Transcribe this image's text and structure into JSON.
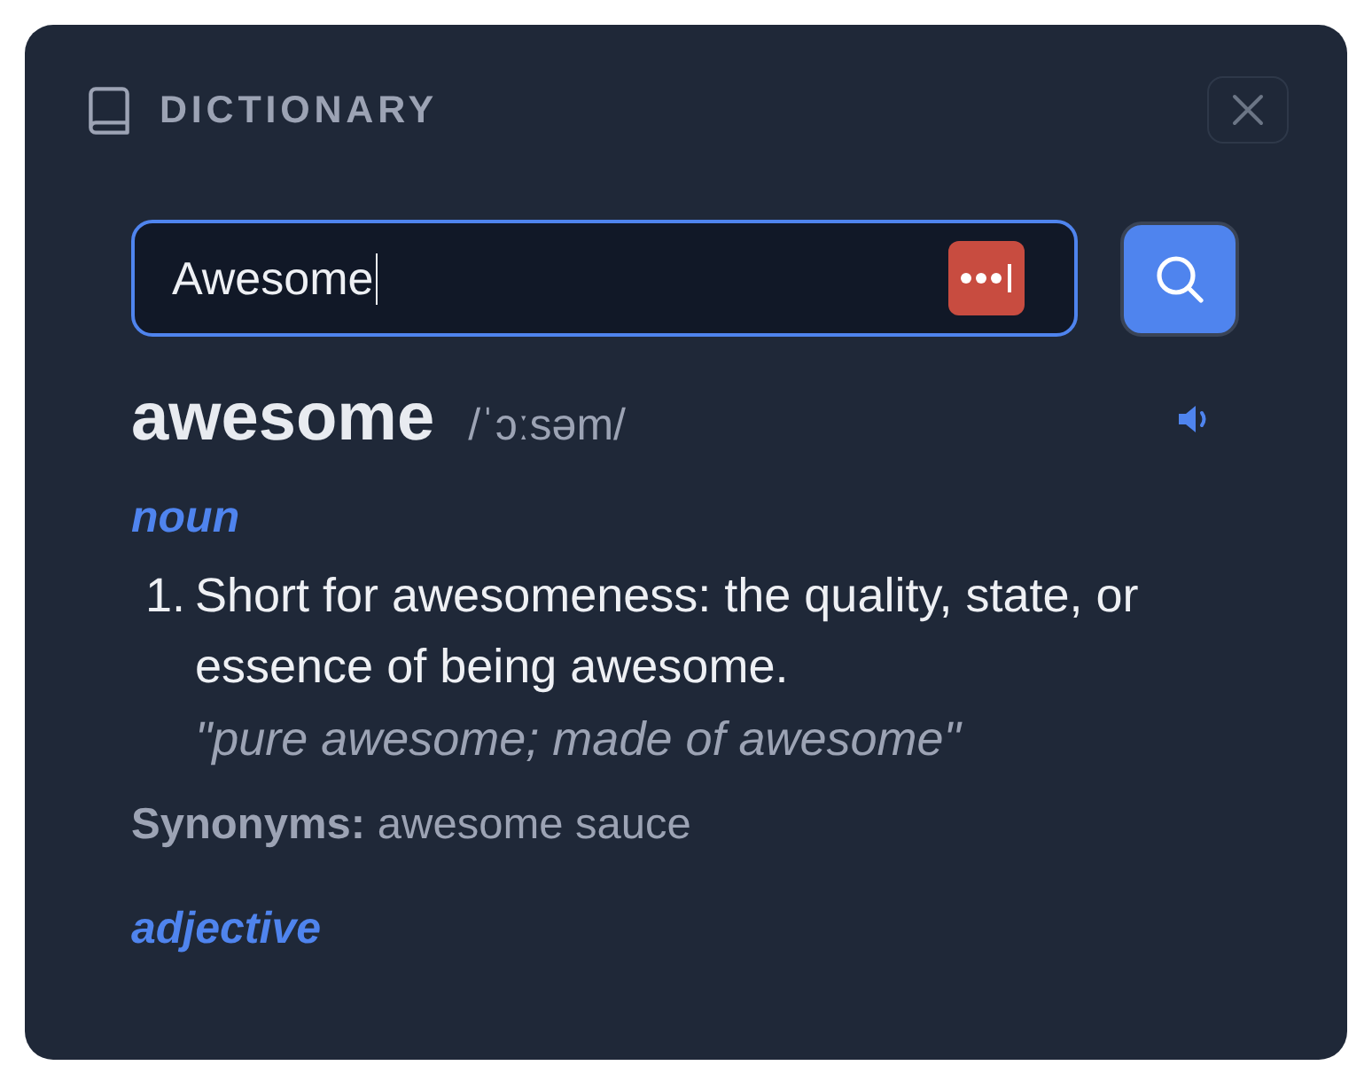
{
  "header": {
    "title": "DICTIONARY"
  },
  "search": {
    "value": "Awesome",
    "focused": true
  },
  "entry": {
    "word": "awesome",
    "phonetic": "/ˈɔːsəm/",
    "senses": [
      {
        "part_of_speech": "noun",
        "definitions": [
          {
            "number": "1.",
            "text": "Short for awesomeness: the quality, state, or essence of being awesome.",
            "example": "\"pure awesome; made of awesome\""
          }
        ],
        "synonyms": "**Synonyms:** awesome sauce"
      },
      {
        "part_of_speech": "adjective"
      }
    ]
  }
}
